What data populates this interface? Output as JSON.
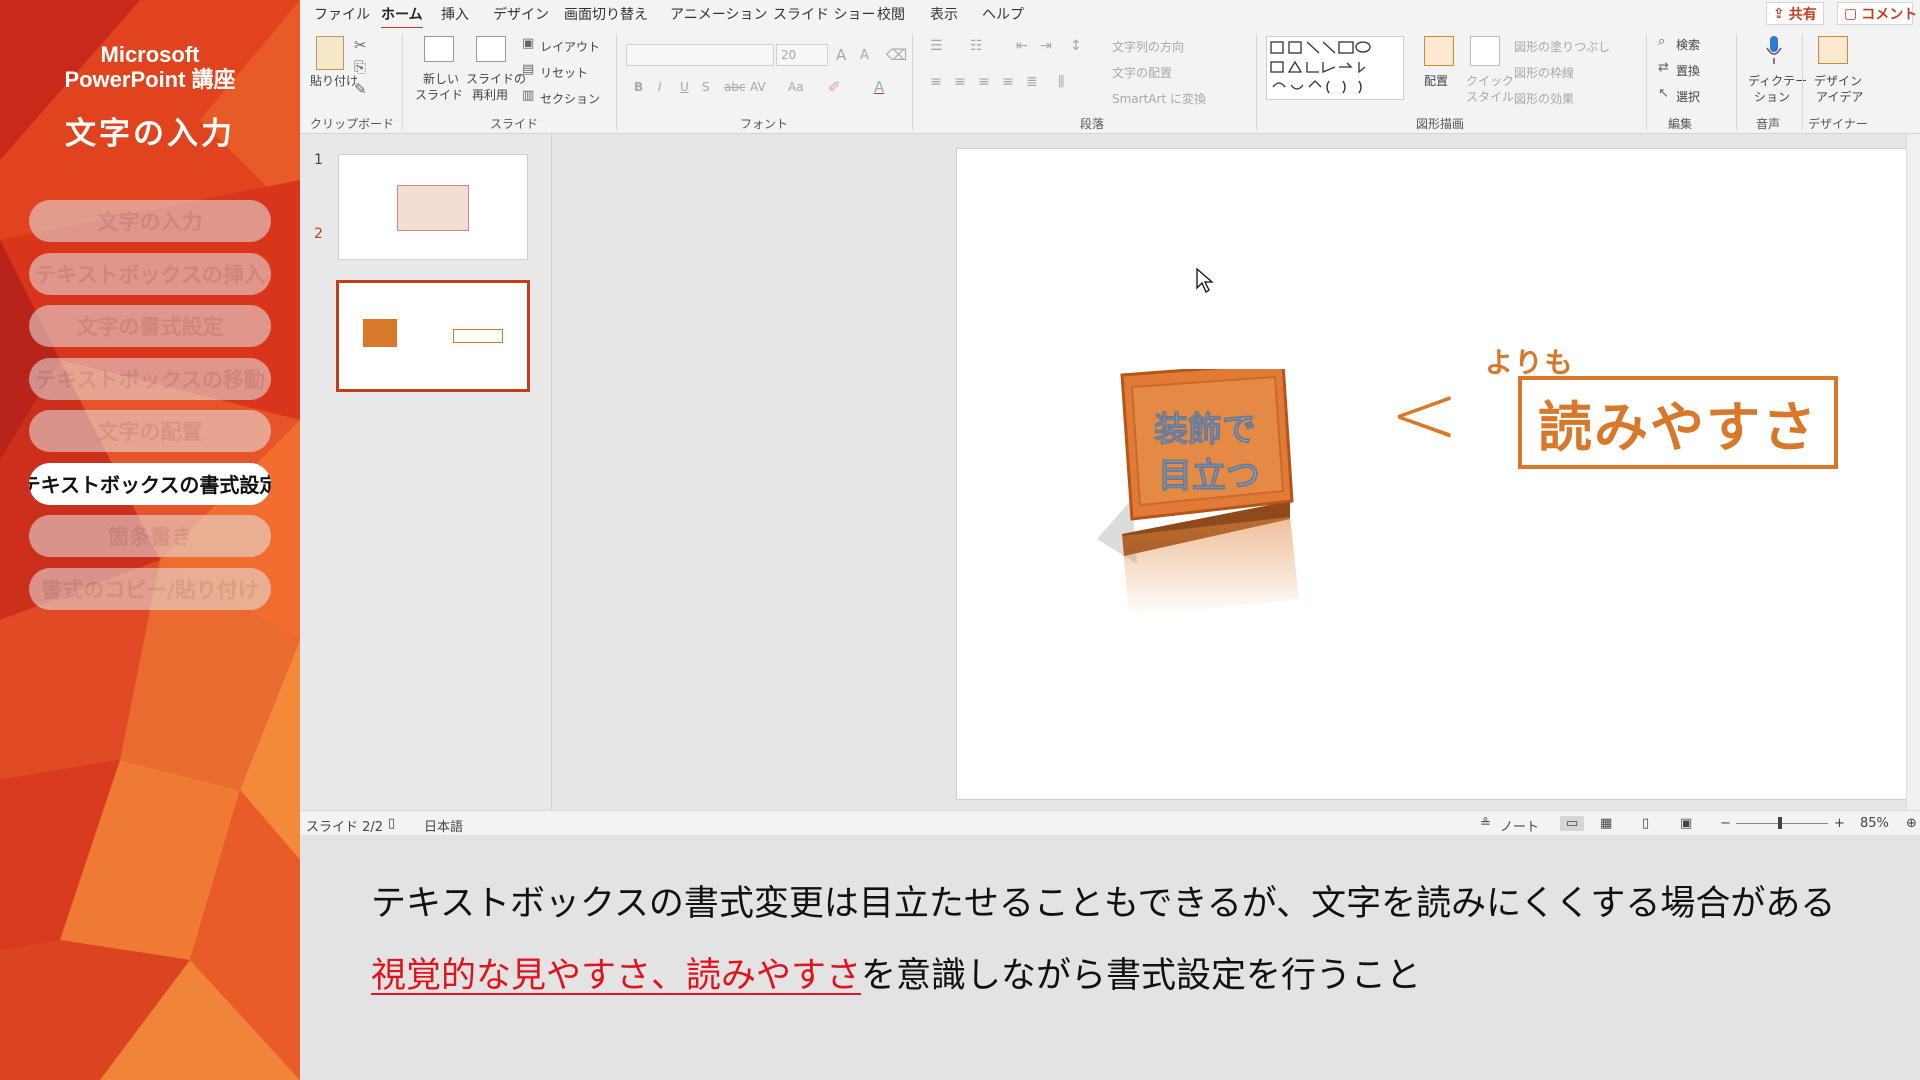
{
  "course": {
    "brand_line1": "Microsoft",
    "brand_line2": "PowerPoint 講座",
    "lesson_title": "文字の入力",
    "menu": [
      {
        "label": "文字の入力",
        "active": false
      },
      {
        "label": "テキストボックスの挿入",
        "active": false
      },
      {
        "label": "文字の書式設定",
        "active": false
      },
      {
        "label": "テキストボックスの移動",
        "active": false
      },
      {
        "label": "文字の配置",
        "active": false
      },
      {
        "label": "テキストボックスの書式設定",
        "active": true
      },
      {
        "label": "箇条書き",
        "active": false
      },
      {
        "label": "書式のコピー/貼り付け",
        "active": false
      }
    ]
  },
  "app": {
    "tabs": [
      "ファイル",
      "ホーム",
      "挿入",
      "デザイン",
      "画面切り替え",
      "アニメーション",
      "スライド ショー",
      "校閲",
      "表示",
      "ヘルプ"
    ],
    "active_tab": "ホーム",
    "share_label": "共有",
    "comment_label": "コメント",
    "ribbon": {
      "clipboard": {
        "paste": "貼り付け",
        "group": "クリップボード"
      },
      "slides": {
        "new_slide_1": "新しい",
        "new_slide_2": "スライド",
        "reuse_1": "スライドの",
        "reuse_2": "再利用",
        "layout": "レイアウト",
        "reset": "リセット",
        "section": "セクション",
        "group": "スライド"
      },
      "font": {
        "font_size": "20",
        "group": "フォント",
        "bold": "B",
        "italic": "I",
        "underline": "U",
        "strike": "S",
        "spacing": "AV",
        "case": "Aa",
        "grow": "A",
        "shrink": "A"
      },
      "paragraph": {
        "text_direction": "文字列の方向",
        "align_text": "文字の配置",
        "smartart": "SmartArt に変換",
        "group": "段落"
      },
      "drawing": {
        "arrange": "配置",
        "quick_1": "クイック",
        "quick_2": "スタイル",
        "fill": "図形の塗りつぶし",
        "outline": "図形の枠線",
        "effects": "図形の効果",
        "group": "図形描画"
      },
      "editing": {
        "find": "検索",
        "replace": "置換",
        "select": "選択",
        "group": "編集"
      },
      "voice": {
        "dictate_1": "ディクテー",
        "dictate_2": "ション",
        "group": "音声"
      },
      "designer": {
        "ideas_1": "デザイン",
        "ideas_2": "アイデア",
        "group": "デザイナー"
      }
    },
    "thumbnails": [
      {
        "number": "1"
      },
      {
        "number": "2"
      }
    ],
    "slide": {
      "decorated_line1": "装飾で",
      "decorated_line2": "目立つ",
      "yorimo": "よりも",
      "less_than": "<",
      "readable": "読みやすさ"
    },
    "status": {
      "slide_counter": "スライド 2/2",
      "language": "日本語",
      "notes": "ノート",
      "zoom": "85%"
    }
  },
  "caption": {
    "line1": "テキストボックスの書式変更は目立たせることもできるが、文字を読みにくくする場合がある",
    "line2_highlight": "視覚的な見やすさ、読みやすさ",
    "line2_rest": "を意識しながら書式設定を行うこと"
  },
  "colors": {
    "accent": "#c43e1c",
    "slide_orange": "#d8782b",
    "highlight_red": "#e0141e"
  }
}
